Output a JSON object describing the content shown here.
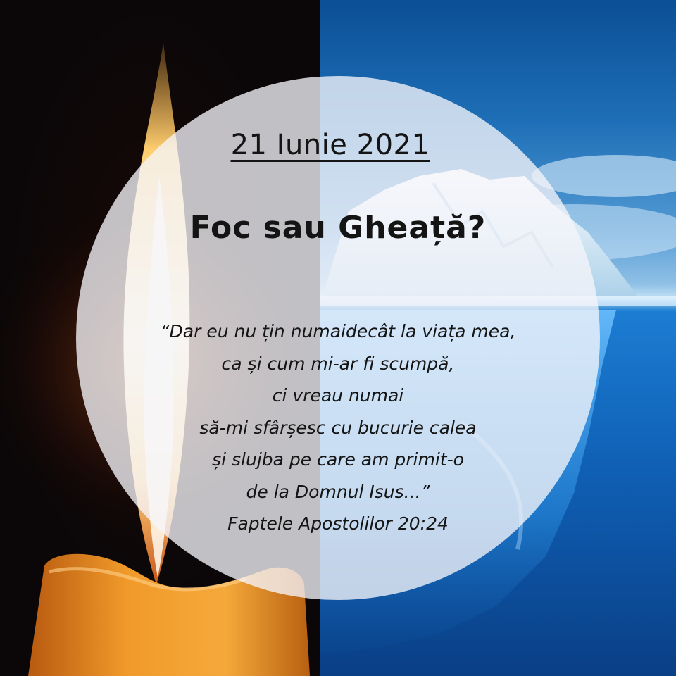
{
  "date": "21 Iunie 2021",
  "title": "Foc sau Gheață?",
  "quote_lines": [
    "“Dar eu nu țin numaidecât la viața mea,",
    "ca și cum mi-ar fi scumpă,",
    "ci vreau numai",
    "să-mi sfârșesc cu bucurie calea",
    "și slujba pe care am primit-o",
    "de la Domnul Isus...”",
    "Faptele Apostolilor 20:24"
  ],
  "colors": {
    "left_background": "#0b0708",
    "candle_wax": "#f0901c",
    "flame_core": "#fff6d8",
    "ice_water": "#0f5fb4",
    "circle_fill": "#f5f5fa"
  },
  "icons": {
    "left_picture": "candle-flame",
    "right_picture": "iceberg"
  }
}
